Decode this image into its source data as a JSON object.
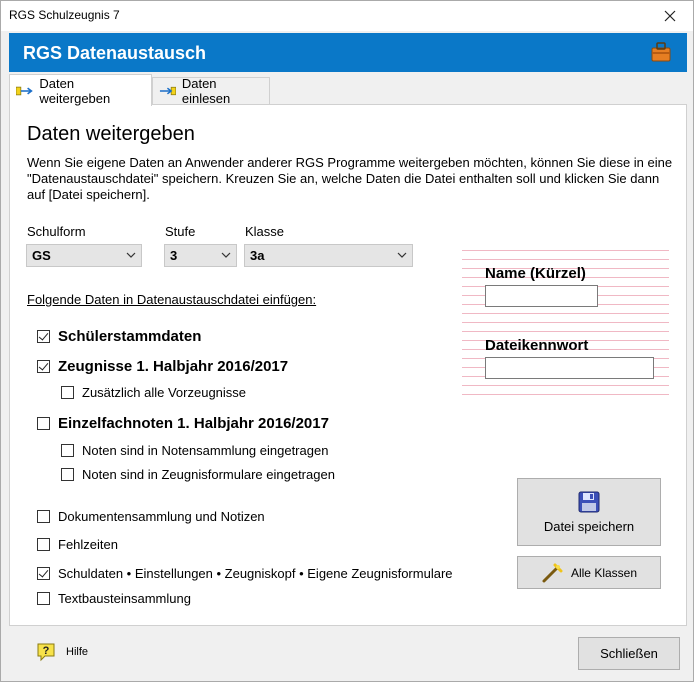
{
  "window": {
    "title": "RGS Schulzeugnis 7"
  },
  "header": {
    "title": "RGS Datenaustausch",
    "icon": "briefcase-icon"
  },
  "tabs": [
    {
      "label": "Daten weitergeben",
      "icon": "export-arrow-icon",
      "active": true
    },
    {
      "label": "Daten einlesen",
      "icon": "import-arrow-icon",
      "active": false
    }
  ],
  "panel": {
    "title": "Daten weitergeben",
    "description": "Wenn Sie eigene Daten an Anwender anderer RGS Programme weitergeben möchten, können Sie diese in eine \"Datenaustauschdatei\" speichern. Kreuzen Sie an, welche Daten die Datei enthalten soll und klicken Sie dann auf [Datei speichern].",
    "fields": {
      "schulform": {
        "label": "Schulform",
        "value": "GS"
      },
      "stufe": {
        "label": "Stufe",
        "value": "3"
      },
      "klasse": {
        "label": "Klasse",
        "value": "3a"
      }
    },
    "section_label": "Folgende Daten in Datenaustauschdatei einfügen:",
    "checkboxes": {
      "stammdaten": {
        "label": "Schülerstammdaten",
        "checked": true
      },
      "zeugnisse": {
        "label": "Zeugnisse 1. Halbjahr 2016/2017",
        "checked": true
      },
      "vorzeugnisse": {
        "label": "Zusätzlich alle Vorzeugnisse",
        "checked": false
      },
      "einzelnoten": {
        "label": "Einzelfachnoten 1. Halbjahr 2016/2017",
        "checked": false
      },
      "notensammlung": {
        "label": "Noten sind in Notensammlung eingetragen",
        "checked": false
      },
      "zeugnisformulare": {
        "label": "Noten sind in Zeugnisformulare eingetragen",
        "checked": false
      },
      "dokumente": {
        "label": "Dokumentensammlung und Notizen",
        "checked": false
      },
      "fehlzeiten": {
        "label": "Fehlzeiten",
        "checked": false
      },
      "schuldaten": {
        "label": "Schuldaten • Einstellungen • Zeugniskopf • Eigene Zeugnisformulare",
        "checked": true
      },
      "textbausteine": {
        "label": "Textbausteinsammlung",
        "checked": false
      }
    },
    "name_label": "Name (Kürzel)",
    "name_value": "",
    "password_label": "Dateikennwort",
    "password_value": "",
    "save_button": "Datei speichern",
    "classes_button": "Alle Klassen"
  },
  "footer": {
    "help_label": "Hilfe",
    "close_button": "Schließen"
  }
}
